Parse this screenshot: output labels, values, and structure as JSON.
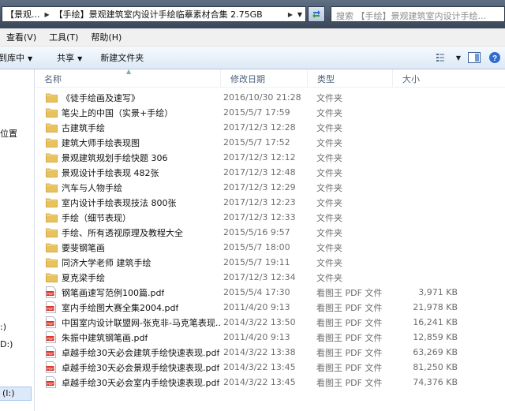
{
  "address": {
    "crumbs": [
      "【景观...",
      "【手绘】景观建筑室内设计手绘临摹素材合集 2.75GB"
    ],
    "search_placeholder": "搜索 【手绘】景观建筑室内设计手绘..."
  },
  "menu": [
    "查看(V)",
    "工具(T)",
    "帮助(H)"
  ],
  "commands": {
    "library": "到库中",
    "share": "共享",
    "new_folder": "新建文件夹"
  },
  "nav": {
    "item_location": "位置",
    "drive_c": ":)",
    "drive_d": "D:)",
    "drive_i": "(I:)"
  },
  "columns": {
    "name": "名称",
    "date": "修改日期",
    "type": "类型",
    "size": "大小"
  },
  "files": [
    {
      "kind": "folder",
      "name": "《徒手绘画及速写》",
      "date": "2016/10/30 21:28",
      "type": "文件夹",
      "size": ""
    },
    {
      "kind": "folder",
      "name": "笔尖上的中国（实景+手绘）",
      "date": "2015/5/7 17:59",
      "type": "文件夹",
      "size": ""
    },
    {
      "kind": "folder",
      "name": "古建筑手绘",
      "date": "2017/12/3 12:28",
      "type": "文件夹",
      "size": ""
    },
    {
      "kind": "folder",
      "name": "建筑大师手绘表现图",
      "date": "2015/5/7 17:52",
      "type": "文件夹",
      "size": ""
    },
    {
      "kind": "folder",
      "name": "景观建筑规划手绘快题 306",
      "date": "2017/12/3 12:12",
      "type": "文件夹",
      "size": ""
    },
    {
      "kind": "folder",
      "name": "景观设计手绘表现 482张",
      "date": "2017/12/3 12:48",
      "type": "文件夹",
      "size": ""
    },
    {
      "kind": "folder",
      "name": "汽车与人物手绘",
      "date": "2017/12/3 12:29",
      "type": "文件夹",
      "size": ""
    },
    {
      "kind": "folder",
      "name": "室内设计手绘表现技法 800张",
      "date": "2017/12/3 12:23",
      "type": "文件夹",
      "size": ""
    },
    {
      "kind": "folder",
      "name": "手绘（细节表现）",
      "date": "2017/12/3 12:33",
      "type": "文件夹",
      "size": ""
    },
    {
      "kind": "folder",
      "name": "手绘、所有透视原理及教程大全",
      "date": "2015/5/16 9:57",
      "type": "文件夹",
      "size": ""
    },
    {
      "kind": "folder",
      "name": "要斐钢笔画",
      "date": "2015/5/7 18:00",
      "type": "文件夹",
      "size": ""
    },
    {
      "kind": "folder",
      "name": "同济大学老师  建筑手绘",
      "date": "2015/5/7 19:11",
      "type": "文件夹",
      "size": ""
    },
    {
      "kind": "folder",
      "name": "夏克梁手绘",
      "date": "2017/12/3 12:34",
      "type": "文件夹",
      "size": ""
    },
    {
      "kind": "pdf",
      "name": "钢笔画速写范例100篇.pdf",
      "date": "2015/5/4 17:30",
      "type": "看图王 PDF 文件",
      "size": "3,971 KB"
    },
    {
      "kind": "pdf",
      "name": "室内手绘图大赛全集2004.pdf",
      "date": "2011/4/20 9:13",
      "type": "看图王 PDF 文件",
      "size": "21,978 KB"
    },
    {
      "kind": "pdf",
      "name": "中国室内设计联盟网-张克非-马克笔表现...",
      "date": "2014/3/22 13:50",
      "type": "看图王 PDF 文件",
      "size": "16,241 KB"
    },
    {
      "kind": "pdf",
      "name": "朱振中建筑钢笔画.pdf",
      "date": "2011/4/20 9:13",
      "type": "看图王 PDF 文件",
      "size": "12,859 KB"
    },
    {
      "kind": "pdf",
      "name": "卓越手绘30天必会建筑手绘快速表现.pdf",
      "date": "2014/3/22 13:38",
      "type": "看图王 PDF 文件",
      "size": "63,269 KB"
    },
    {
      "kind": "pdf",
      "name": "卓越手绘30天必会景观手绘快速表现.pdf",
      "date": "2014/3/22 13:45",
      "type": "看图王 PDF 文件",
      "size": "81,250 KB"
    },
    {
      "kind": "pdf",
      "name": "卓越手绘30天必会室内手绘快速表现.pdf",
      "date": "2014/3/22 13:45",
      "type": "看图王 PDF 文件",
      "size": "74,376 KB"
    }
  ],
  "colors": {
    "folder": "#e8c25a",
    "pdf": "#d9362b",
    "header_text": "#4c607a"
  },
  "icons": {
    "folder": "folder-icon",
    "pdf": "pdf-file-icon",
    "refresh": "refresh-icon",
    "views": "view-options-icon",
    "preview": "preview-pane-icon",
    "help": "help-icon"
  }
}
